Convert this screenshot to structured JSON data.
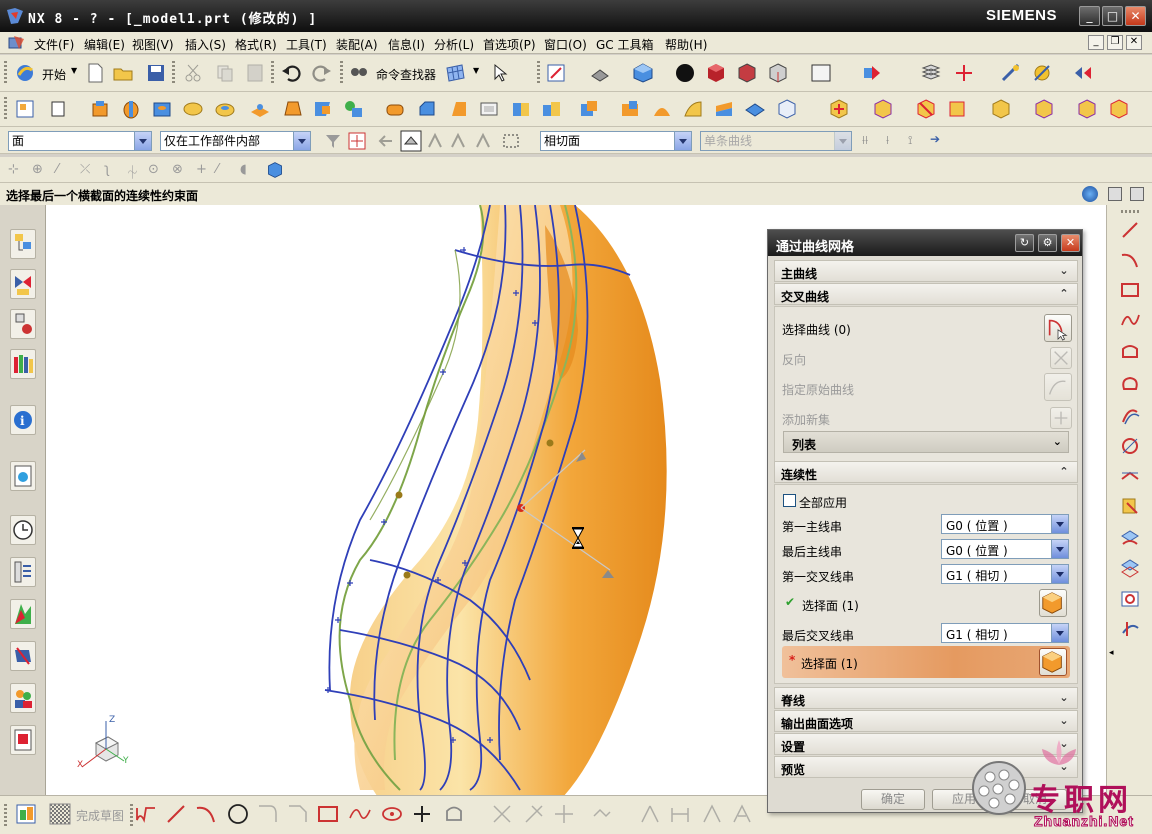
{
  "titlebar": {
    "title": "NX 8 - ? - [_model1.prt  (修改的) ]",
    "brand": "SIEMENS",
    "minimize": "_",
    "maximize": "□",
    "close": "✕"
  },
  "menubar": {
    "items": [
      "文件(F)",
      "编辑(E)",
      "视图(V)",
      "插入(S)",
      "格式(R)",
      "工具(T)",
      "装配(A)",
      "信息(I)",
      "分析(L)",
      "首选项(P)",
      "窗口(O)",
      "GC 工具箱",
      "帮助(H)"
    ]
  },
  "toolbar1": {
    "start_label": "开始",
    "command_finder_label": "命令查找器"
  },
  "selection_bar": {
    "filter_type": "面",
    "scope": "仅在工作部件内部",
    "face_rule": "相切面",
    "curve_rule": "单条曲线"
  },
  "status": {
    "prompt": "选择最后一个横截面的连续性约束面"
  },
  "dialog": {
    "title": "通过曲线网格",
    "sections": {
      "primary": "主曲线",
      "cross": "交叉曲线",
      "continuity": "连续性",
      "spine": "脊线",
      "output": "输出曲面选项",
      "settings": "设置",
      "preview": "预览"
    },
    "cross": {
      "select_curve": "选择曲线 (0)",
      "reverse": "反向",
      "specify_origin": "指定原始曲线",
      "add_new_set": "添加新集",
      "list": "列表"
    },
    "continuity": {
      "apply_all": "全部应用",
      "first_primary_label": "第一主线串",
      "first_primary_value": "G0 ( 位置 )",
      "last_primary_label": "最后主线串",
      "last_primary_value": "G0 ( 位置 )",
      "first_cross_label": "第一交叉线串",
      "first_cross_value": "G1 ( 相切 )",
      "select_face_1": "选择面 (1)",
      "last_cross_label": "最后交叉线串",
      "last_cross_value": "G1 ( 相切 )",
      "select_face_2": "选择面 (1)"
    },
    "buttons": {
      "ok": "确定",
      "apply": "应用",
      "cancel": "取消"
    }
  },
  "bottom_toolbar": {
    "finish_sketch": "完成草图"
  },
  "watermark": {
    "text": "专职网",
    "url": "Zhuanzhi.Net"
  },
  "triad": {
    "x": "X",
    "y": "Y",
    "z": "Z"
  },
  "colors": {
    "titlebar": "#1a1a1a",
    "surface": "#f2a93c",
    "curve_blue": "#2f3fb8",
    "curve_green": "#7ea64a",
    "highlight_row": "#e59a60"
  }
}
